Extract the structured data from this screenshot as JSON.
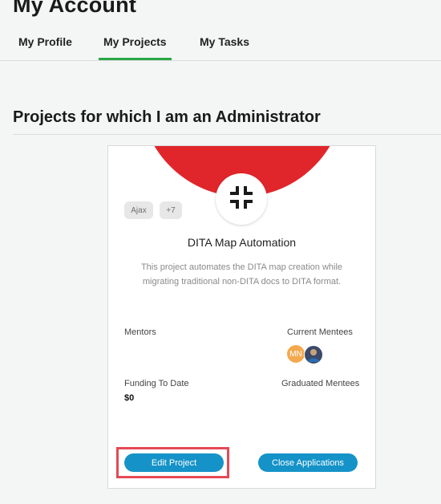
{
  "page": {
    "title": "My Account"
  },
  "tabs": [
    {
      "label": "My Profile",
      "active": false
    },
    {
      "label": "My Projects",
      "active": true
    },
    {
      "label": "My Tasks",
      "active": false
    }
  ],
  "section": {
    "title": "Projects for which I am an Administrator"
  },
  "project_card": {
    "banner_color": "#e0262b",
    "logo_icon": "arrows-inward-icon",
    "tags": [
      "Ajax",
      "+7"
    ],
    "title": "DITA Map Automation",
    "description": "This project automates the DITA map creation while migrating traditional non-DITA docs to DITA format.",
    "mentors_label": "Mentors",
    "current_mentees_label": "Current Mentees",
    "mentees": [
      {
        "initials": "MN",
        "color": "#f4a94f"
      },
      {
        "initials": "",
        "color": "#3a4a6a"
      }
    ],
    "funding_label": "Funding To Date",
    "funding_value": "$0",
    "graduated_label": "Graduated Mentees",
    "edit_button": "Edit Project",
    "close_button": "Close Applications"
  },
  "colors": {
    "accent_tab": "#28a745",
    "button": "#1593c8",
    "highlight": "#e34a55"
  }
}
